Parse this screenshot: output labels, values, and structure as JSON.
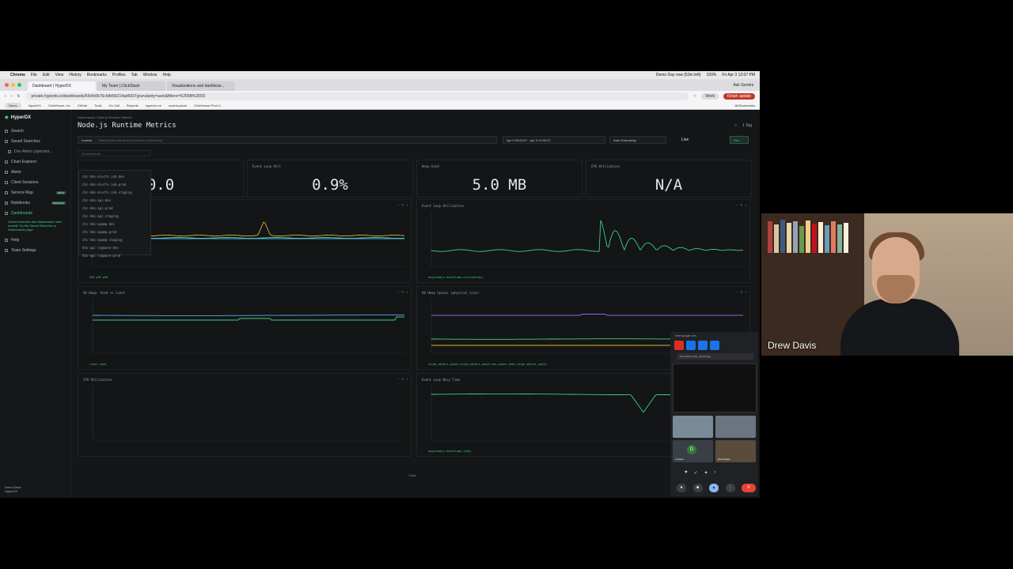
{
  "menubar": {
    "items": [
      "Chrome",
      "File",
      "Edit",
      "View",
      "History",
      "Bookmarks",
      "Profiles",
      "Tab",
      "Window",
      "Help"
    ],
    "status": "Demo Day now (53m left)",
    "battery": "100%",
    "clock": "Fri Apr 3 12:07 PM"
  },
  "tabs": [
    {
      "label": "Dashboard | HyperDX",
      "active": true
    },
    {
      "label": "My Team | ClickStack",
      "active": false
    },
    {
      "label": "Visualizations and dashboar...",
      "active": false
    }
  ],
  "ask_gemini": "Ask Gemini",
  "address": {
    "url": "private.hyperdx.io/dashboards/69cfe0b76c9db5b214ad6937granularity=auto&filters=%255B%255D",
    "work": "Work",
    "finish_update": "Finish update",
    "demo": "Demo"
  },
  "bookmarks": [
    "HyperDX",
    "ClickHouse, Inc",
    "GitHub",
    "Tools",
    "On Call",
    "Repords",
    "hyperdx-ee",
    "control-plane",
    "ClickHouse Prod C..."
  ],
  "all_bookmarks": "All Bookmarks",
  "app": {
    "brand": "HyperDX",
    "nav": [
      {
        "label": "Search",
        "active": false,
        "sub": false
      },
      {
        "label": "Saved Searches",
        "active": false,
        "sub": false
      },
      {
        "label": "Dev Alerts (operator...",
        "active": false,
        "sub": true
      },
      {
        "label": "Chart Explorer",
        "active": false,
        "sub": false
      },
      {
        "label": "Alerts",
        "active": false,
        "sub": false
      },
      {
        "label": "Client Sessions",
        "active": false,
        "sub": false
      },
      {
        "label": "Service Map",
        "active": false,
        "sub": false,
        "badge": "BETA"
      },
      {
        "label": "Notebooks",
        "active": false,
        "sub": false,
        "badge": "PREVIEW"
      },
      {
        "label": "Dashboards",
        "active": true,
        "sub": false
      }
    ],
    "note": "Saved searches and dashboards have moved! Try the Saved Searches or Dashboards page.",
    "nav_bottom": [
      "Help",
      "Team Settings"
    ],
    "user": {
      "name": "Drew Davis",
      "team": "HyperDX"
    }
  },
  "dashboard": {
    "breadcrumb": "Dashboards  /  Node.js Runtime Metrics",
    "title": "Node.js Runtime Metrics",
    "tag": "1 Tag",
    "query_lang": "Lucene",
    "query_placeholder": "Search your events w/ Lucene ex. column:foo",
    "time_range": "Apr 3 09:00:07 - Apr 3 10:00:07",
    "granularity": "Auto Granularity",
    "live": "Live",
    "run": "Run",
    "filter_placeholder": "ServiceName",
    "add": "+ Add"
  },
  "service_dropdown": [
    "chc-hdx-alerts-job-dev",
    "chc-hdx-alerts-job-prod",
    "chc-hdx-alerts-job-staging",
    "chc-hdx-api-dev",
    "chc-hdx-api-prod",
    "chc-hdx-api-staging",
    "chc-hdx-opamp-dev",
    "chc-hdx-opamp-prod",
    "chc-hdx-opamp-staging",
    "hdx-api-logbase-dev",
    "hdx-api-logbase-prod"
  ],
  "stats": [
    {
      "label": "",
      "value": "0.0"
    },
    {
      "label": "Event Loop Util",
      "value": "0.9%"
    },
    {
      "label": "Heap Used",
      "value": "5.0 MB"
    },
    {
      "label": "CPU Utilization",
      "value": "N/A"
    }
  ],
  "charts": [
    {
      "label": "",
      "legend": "p99  p95  p50"
    },
    {
      "label": "Event Loop Utilization",
      "legend": "avg(nodejs.eventloop.utilization)"
    },
    {
      "label": "V8 Heap: Used vs Limit",
      "legend": "limit  used"
    },
    {
      "label": "V8 Heap Spaces (physical size)",
      "legend": "large_object_space   large_object_space   new_space   code_large_object_space"
    },
    {
      "label": "CPU Utilization",
      "legend": ""
    },
    {
      "label": "Event Loop Busy Time",
      "legend": "avg(nodejs.eventloop.time)"
    }
  ],
  "meet": {
    "url": "meet.google.com",
    "presenting": "Drew Davis (You, presenting)",
    "others": "4 others",
    "avatar_letter": "D",
    "self_label": "Drew Davis"
  },
  "webcam": {
    "name": "Drew Davis"
  },
  "colors": {
    "accent": "#3ecf8e",
    "meet_end": "#ea4335",
    "chart_yellow": "#e0b030",
    "chart_purple": "#8e6bd6"
  }
}
